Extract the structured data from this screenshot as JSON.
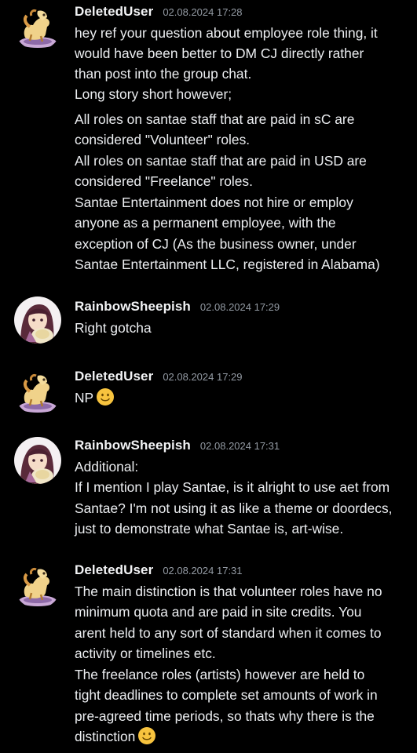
{
  "messages": [
    {
      "username": "DeletedUser",
      "timestamp": "02.08.2024 17:28",
      "avatar": "horse-avatar-icon",
      "lines": [
        "hey ref your question about employee role thing, it",
        "would have been better to DM CJ directly rather",
        "than post into the group chat.",
        "Long story short however;",
        "All roles on santae staff that are paid in sC are",
        "considered \"Volunteer\" roles.",
        "All roles on santae staff that are paid in USD are",
        "considered \"Freelance\" roles.",
        "Santae Entertainment does not hire or employ",
        "anyone as a permanent employee, with the",
        "exception of CJ (As the business owner, under",
        "Santae Entertainment LLC, registered in Alabama)"
      ]
    },
    {
      "username": "RainbowSheepish",
      "timestamp": "02.08.2024 17:29",
      "avatar": "sheep-girl-avatar-icon",
      "lines": [
        "Right gotcha"
      ]
    },
    {
      "username": "DeletedUser",
      "timestamp": "02.08.2024 17:29",
      "avatar": "horse-avatar-icon",
      "lines": [
        "NP"
      ],
      "emoji": "slightly-smiling-face-emoji"
    },
    {
      "username": "RainbowSheepish",
      "timestamp": "02.08.2024 17:31",
      "avatar": "sheep-girl-avatar-icon",
      "lines": [
        "Additional:",
        "If I mention I play Santae, is it alright to use aet from",
        "Santae? I'm not using it as like a theme or doordecs,",
        "just to demonstrate what Santae is, art-wise."
      ]
    },
    {
      "username": "DeletedUser",
      "timestamp": "02.08.2024 17:31",
      "avatar": "horse-avatar-icon",
      "lines": [
        "The main distinction is that volunteer roles have no",
        "minimum quota and are paid in site credits. You",
        "arent held to any sort of standard when it comes to",
        "activity or timelines etc.",
        "The freelance roles (artists) however are held to",
        "tight deadlines to complete set amounts of work in",
        "pre-agreed time periods, so thats why there is the",
        "distinction"
      ],
      "emoji": "slightly-smiling-face-emoji"
    }
  ],
  "colors": {
    "background": "#000000",
    "username": "#f2f3f5",
    "timestamp": "#949ba4",
    "text": "#eceef1",
    "emoji": "#f7c33e"
  }
}
